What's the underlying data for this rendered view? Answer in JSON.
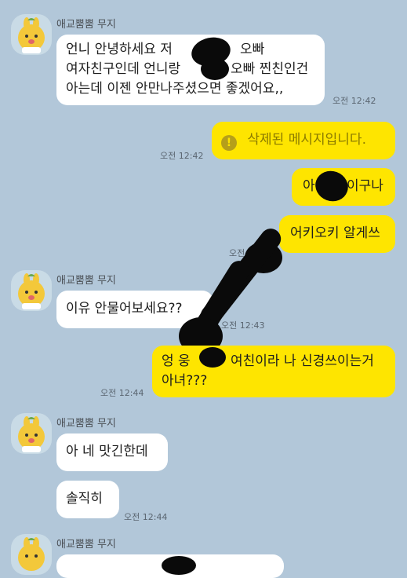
{
  "chat": {
    "sender_name": "애교뿜뿜 무지",
    "messages": [
      {
        "id": "m1",
        "lines": [
          "언니 안녕하세요 저",
          "여자친구인데 언니랑",
          "아는데 이젠 안만나주셨으면 좋겠어요,,"
        ],
        "fragments": [
          "오빠",
          "오빠 찐친인건"
        ],
        "time": "오전 12:42"
      },
      {
        "id": "m2",
        "text": "삭제된 메시지입니다.",
        "time": "오전 12:42"
      },
      {
        "id": "m3",
        "text_left": "아",
        "text_right": "이구나"
      },
      {
        "id": "m4",
        "text": "어키오키 알게쓰",
        "time_fragment": "오전"
      },
      {
        "id": "m5",
        "text": "이유 안물어보세요??",
        "time": "오전 12:43"
      },
      {
        "id": "m6",
        "line1_left": "엉 웅",
        "line1_right": "여친이라 나 신경쓰이는거",
        "line2": "아녀???",
        "time": "오전 12:44"
      },
      {
        "id": "m7",
        "text": "아 네 맛긴한데"
      },
      {
        "id": "m8",
        "text": "솔직히",
        "time": "오전 12:44"
      }
    ]
  },
  "colors": {
    "background": "#b2c7d9",
    "incoming_bubble": "#ffffff",
    "outgoing_bubble": "#fee500",
    "redaction": "#0a0a0a"
  },
  "icons": {
    "avatar": "yellow-character-avatar-icon",
    "deleted": "exclamation-circle-icon"
  }
}
